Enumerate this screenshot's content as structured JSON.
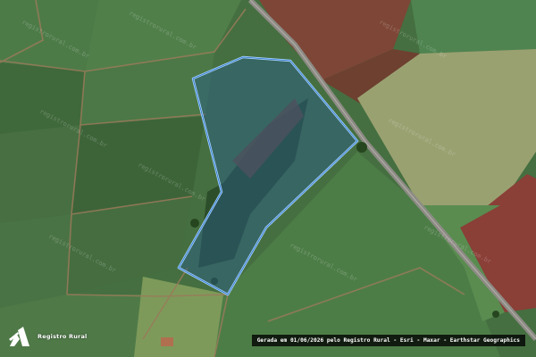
{
  "map": {
    "imagery": "satellite",
    "colors": {
      "field_green": "#4a7a45",
      "field_dark": "#355d33",
      "bare_soil": "#8a4a3a",
      "road": "#8c8a84",
      "boundary": "#a9d4ff",
      "boundary_fill": "rgba(40,90,140,0.45)"
    },
    "watermark_text": "registrorural.com.br",
    "boundary_label": "property-boundary"
  },
  "branding": {
    "logo_text": "Registro Rural",
    "logo_icon": "registro-rural-logo-icon"
  },
  "attribution": {
    "text": "Gerada em 01/06/2026 pelo Registro Rural - Esri - Maxar - Earthstar Geographics"
  }
}
